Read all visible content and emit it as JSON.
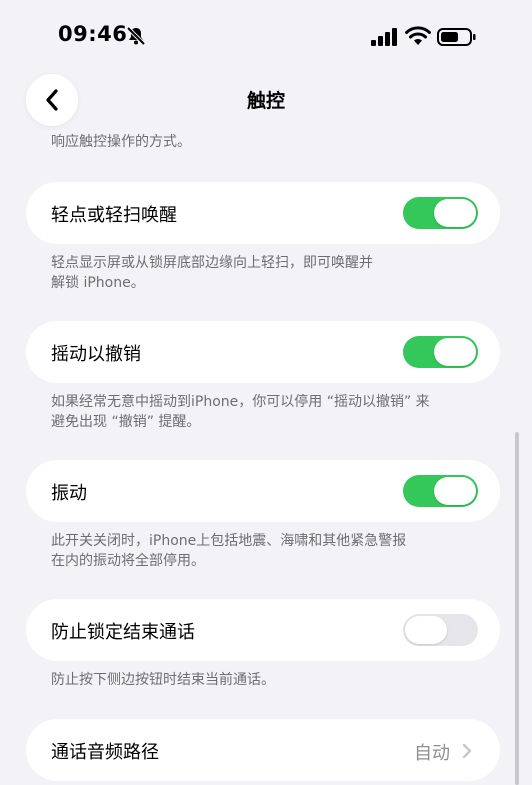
{
  "status": {
    "time": "09:46"
  },
  "icons": {
    "mute": "bell-slash-icon",
    "signal": "cellular-signal-icon",
    "wifi": "wifi-icon",
    "battery": "battery-icon",
    "back": "chevron-left-icon",
    "chevron": "chevron-right-icon"
  },
  "nav": {
    "title": "触控"
  },
  "intro_text": "响应触控操作的方式。",
  "settings": {
    "tap_to_wake": {
      "label": "轻点或轻扫唤醒",
      "on": true,
      "desc_line1": "轻点显示屏或从锁屏底部边缘向上轻扫，即可唤醒并",
      "desc_line2": "解锁 iPhone。"
    },
    "shake_to_undo": {
      "label": "摇动以撤销",
      "on": true,
      "desc_line1": "如果经常无意中摇动到iPhone，你可以停用 “摇动以撤销” 来",
      "desc_line2": "避免出现 “撤销” 提醒。"
    },
    "vibration": {
      "label": "振动",
      "on": true,
      "desc_line1": "此开关关闭时，iPhone上包括地震、海啸和其他紧急警报",
      "desc_line2": "在内的振动将全部停用。"
    },
    "lock_ends_call": {
      "label": "防止锁定结束通话",
      "on": false,
      "desc_line1": "防止按下侧边按钮时结束当前通话。"
    },
    "call_audio": {
      "label": "通话音频路径",
      "value": "自动"
    }
  },
  "colors": {
    "toggle_on": "#34c759",
    "toggle_off": "#e5e5ea",
    "background": "#f2f2f7"
  }
}
